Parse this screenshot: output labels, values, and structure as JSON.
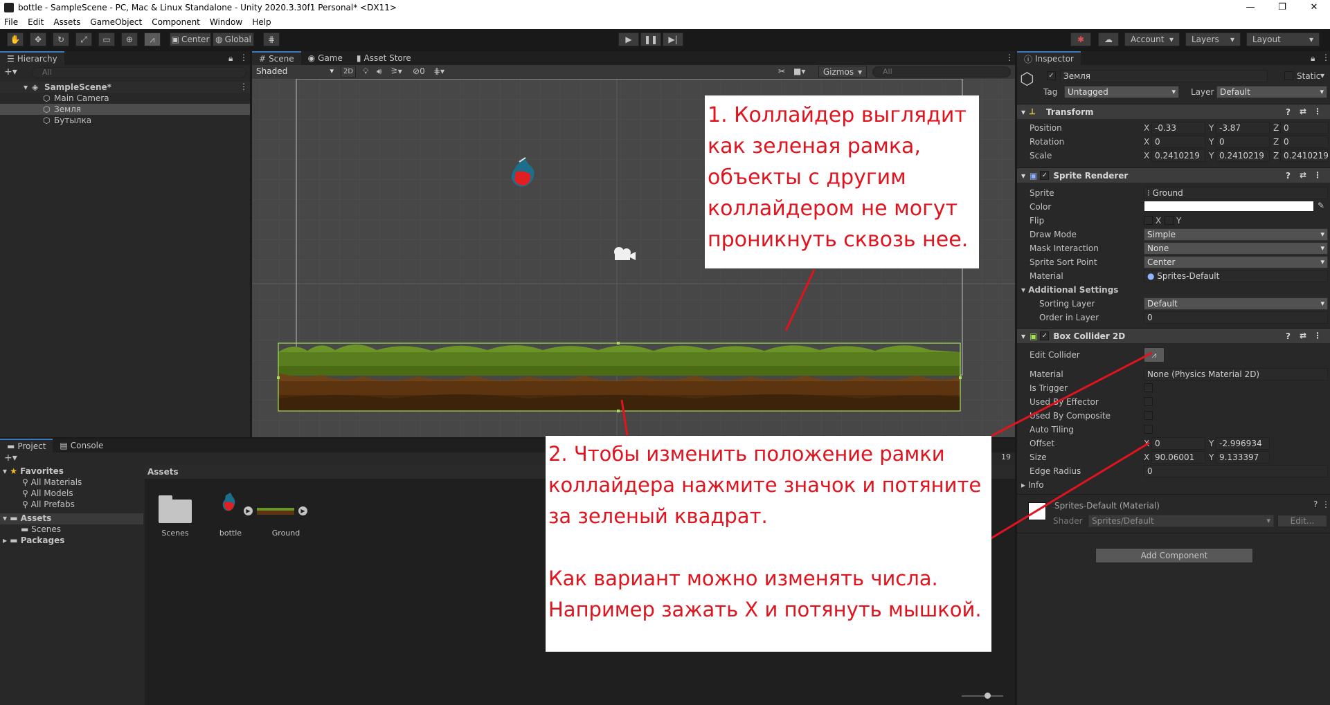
{
  "window": {
    "title": "bottle - SampleScene - PC, Mac & Linux Standalone - Unity 2020.3.30f1 Personal* <DX11>",
    "controls": [
      "—",
      "❐",
      "✕"
    ]
  },
  "menu": [
    "File",
    "Edit",
    "Assets",
    "GameObject",
    "Component",
    "Window",
    "Help"
  ],
  "toolbar": {
    "center": "Center",
    "global": "Global",
    "account": "Account",
    "layers": "Layers",
    "layout": "Layout"
  },
  "hierarchy": {
    "tab": "Hierarchy",
    "search_placeholder": "All",
    "scene": "SampleScene*",
    "items": [
      "Main Camera",
      "Земля",
      "Бутылка"
    ]
  },
  "scene_view": {
    "tabs": [
      "Scene",
      "Game",
      "Asset Store"
    ],
    "shading": "Shaded",
    "mode2d": "2D",
    "hidden_count": "0",
    "gizmos": "Gizmos",
    "search_placeholder": "All"
  },
  "project": {
    "tabs": [
      "Project",
      "Console"
    ],
    "favorites_label": "Favorites",
    "favorites": [
      "All Materials",
      "All Models",
      "All Prefabs"
    ],
    "assets_label": "Assets",
    "asset_folders": [
      "Scenes"
    ],
    "packages_label": "Packages",
    "breadcrumb": "Assets",
    "grid_items": [
      "Scenes",
      "bottle",
      "Ground"
    ],
    "counter": "19"
  },
  "inspector": {
    "tab": "Inspector",
    "object_name": "Земля",
    "static_label": "Static",
    "tag_label": "Tag",
    "tag_value": "Untagged",
    "layer_label": "Layer",
    "layer_value": "Default",
    "transform": {
      "title": "Transform",
      "position": {
        "label": "Position",
        "x": "-0.33",
        "y": "-3.87",
        "z": "0"
      },
      "rotation": {
        "label": "Rotation",
        "x": "0",
        "y": "0",
        "z": "0"
      },
      "scale": {
        "label": "Scale",
        "x": "0.2410219",
        "y": "0.2410219",
        "z": "0.2410219"
      }
    },
    "sprite_renderer": {
      "title": "Sprite Renderer",
      "sprite_label": "Sprite",
      "sprite_value": "Ground",
      "color_label": "Color",
      "color_value": "#ffffff",
      "flip_label": "Flip",
      "flip_x": "X",
      "flip_y": "Y",
      "draw_mode_label": "Draw Mode",
      "draw_mode": "Simple",
      "mask_label": "Mask Interaction",
      "mask_value": "None",
      "sort_point_label": "Sprite Sort Point",
      "sort_point": "Center",
      "material_label": "Material",
      "material_value": "Sprites-Default",
      "additional_label": "Additional Settings",
      "sorting_layer_label": "Sorting Layer",
      "sorting_layer": "Default",
      "order_label": "Order in Layer",
      "order_value": "0"
    },
    "box_collider": {
      "title": "Box Collider 2D",
      "edit_label": "Edit Collider",
      "material_label": "Material",
      "material_value": "None (Physics Material 2D)",
      "trigger_label": "Is Trigger",
      "effector_label": "Used By Effector",
      "composite_label": "Used By Composite",
      "tiling_label": "Auto Tiling",
      "offset_label": "Offset",
      "offset_x": "0",
      "offset_y": "-2.996934",
      "size_label": "Size",
      "size_x": "90.06001",
      "size_y": "9.133397",
      "edge_label": "Edge Radius",
      "edge_value": "0",
      "info_label": "Info"
    },
    "material": {
      "title": "Sprites-Default (Material)",
      "shader_label": "Shader",
      "shader_value": "Sprites/Default",
      "edit_label": "Edit..."
    },
    "add_component": "Add Component"
  },
  "annotations": {
    "note1": [
      "1. Коллайдер выглядит",
      "как зеленая рамка,",
      "объекты с другим",
      "коллайдером не могут",
      "проникнуть сквозь нее."
    ],
    "note2": [
      "2. Чтобы изменить положение рамки",
      "коллайдера нажмите значок и потяните",
      "за зеленый квадрат."
    ],
    "note3": [
      "Как вариант можно изменять числа.",
      "Например зажать X и потянуть мышкой."
    ]
  },
  "colors": {
    "annotation": "#e0141e",
    "collider": "#a4e05a",
    "accent": "#3a79bb"
  }
}
